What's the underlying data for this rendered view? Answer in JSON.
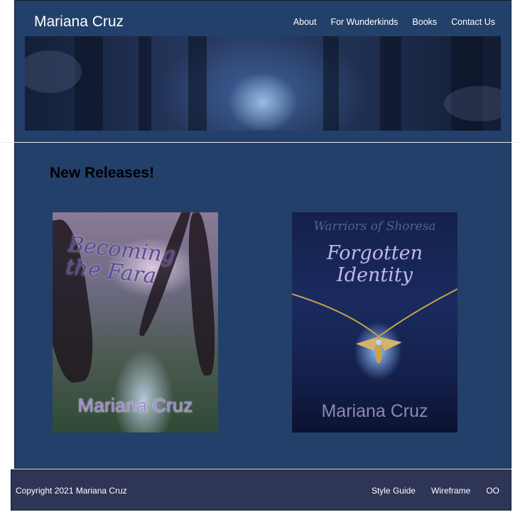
{
  "header": {
    "site_title": "Mariana Cruz",
    "nav": [
      "About",
      "For Wunderkinds",
      "Books",
      "Contact Us"
    ]
  },
  "main": {
    "section_title": "New Releases!",
    "books": [
      {
        "title": "Becoming the Fara",
        "author": "Mariana Cruz"
      },
      {
        "series": "Warriors of Shoresa",
        "title": "Forgotten Identity",
        "author": "Mariana Cruz"
      }
    ]
  },
  "footer": {
    "copyright": "Copyright 2021 Mariana Cruz",
    "links": [
      "Style Guide",
      "Wireframe",
      "OO"
    ]
  },
  "colors": {
    "page_bg": "#22406a",
    "footer_bg": "#2f3556",
    "text": "#ffffff"
  }
}
